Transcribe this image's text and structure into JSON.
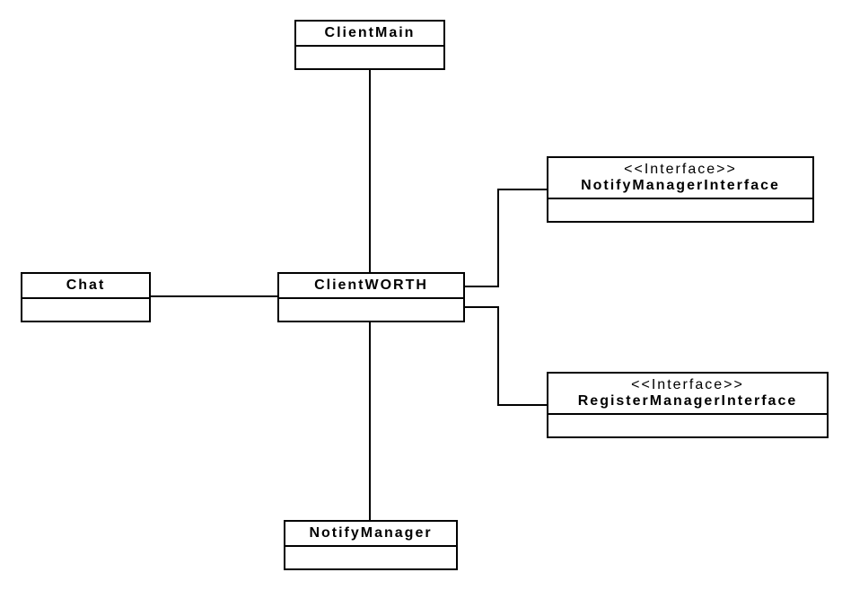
{
  "classes": {
    "client_main": {
      "name": "ClientMain"
    },
    "client_worth": {
      "name": "ClientWORTH"
    },
    "chat": {
      "name": "Chat"
    },
    "notify_manager": {
      "name": "NotifyManager"
    },
    "notify_iface": {
      "stereotype": "<<Interface>>",
      "name": "NotifyManagerInterface"
    },
    "register_iface": {
      "stereotype": "<<Interface>>",
      "name": "RegisterManagerInterface"
    }
  }
}
